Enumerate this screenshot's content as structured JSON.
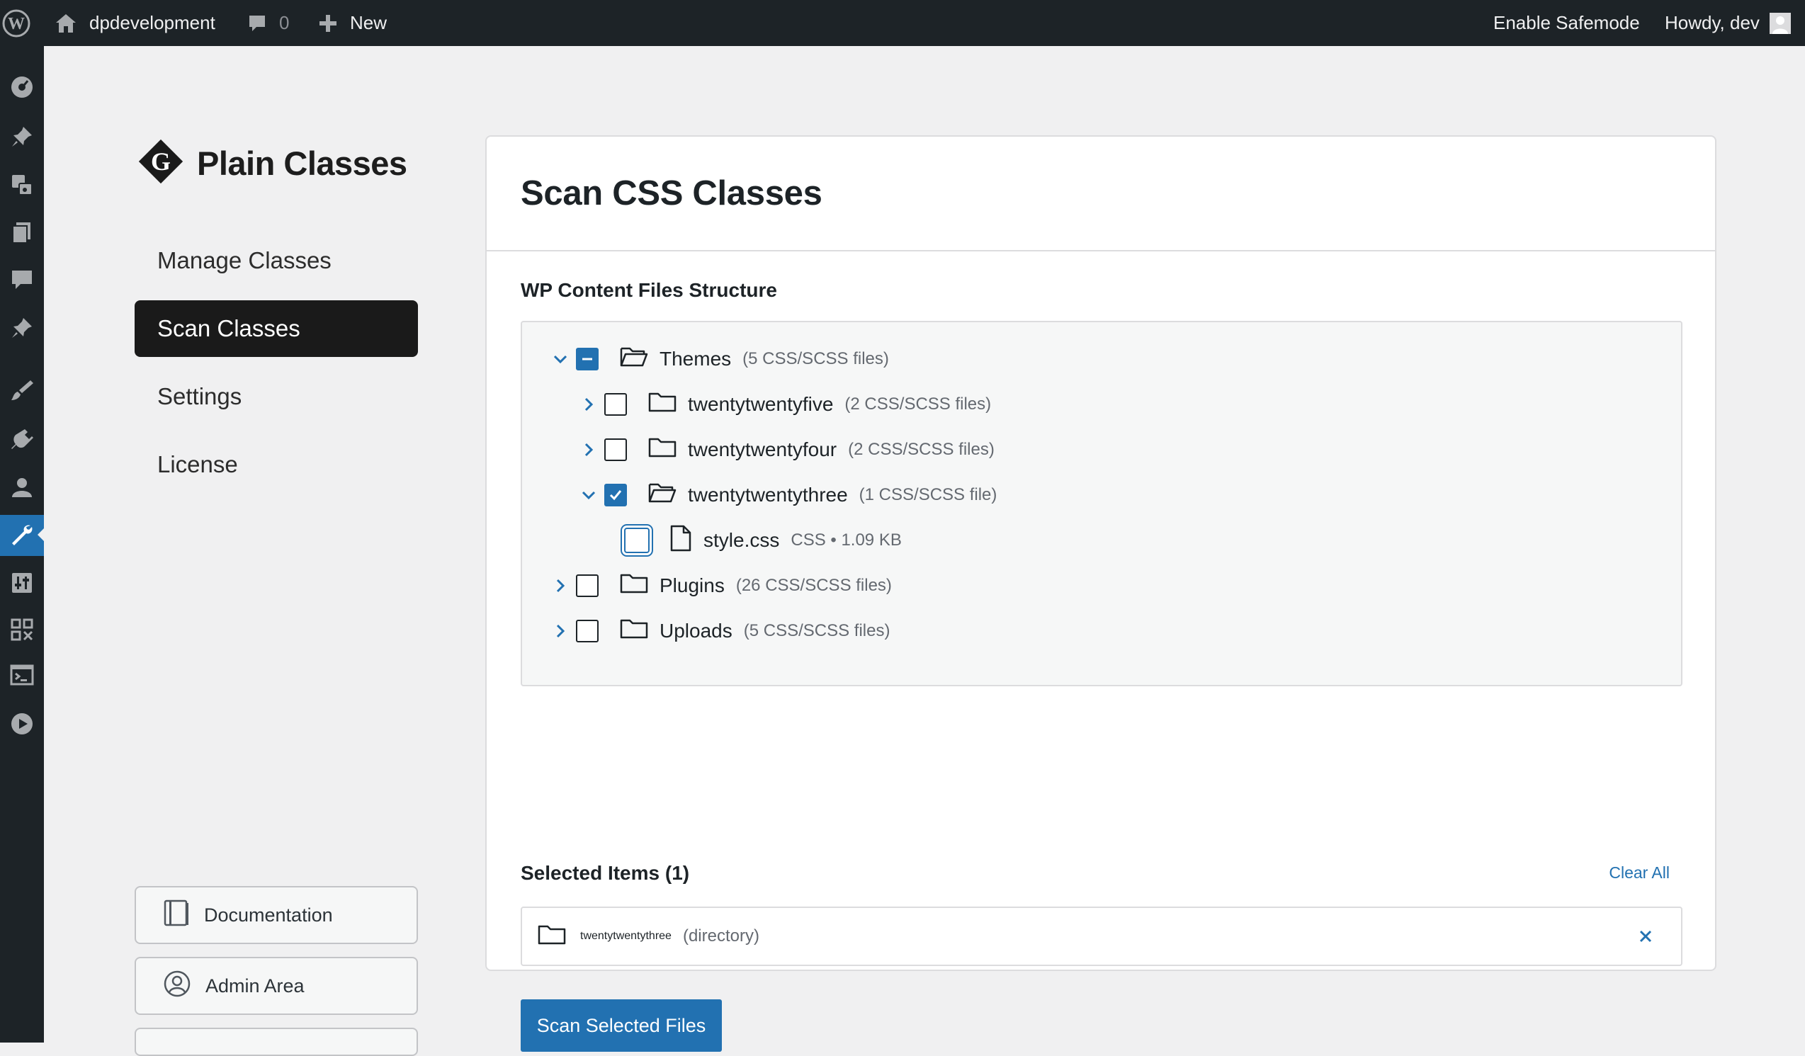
{
  "adminbar": {
    "site_name": "dpdevelopment",
    "comments_count": "0",
    "new_label": "New",
    "safemode_label": "Enable Safemode",
    "howdy_label": "Howdy, dev"
  },
  "sidebar": {
    "brand": "Plain Classes",
    "nav": [
      {
        "label": "Manage Classes"
      },
      {
        "label": "Scan Classes",
        "active": true
      },
      {
        "label": "Settings"
      },
      {
        "label": "License"
      }
    ],
    "buttons": [
      {
        "label": "Documentation",
        "icon": "book-icon"
      },
      {
        "label": "Admin Area",
        "icon": "user-circle-icon"
      }
    ]
  },
  "main": {
    "title": "Scan CSS Classes",
    "section_label": "WP Content Files Structure",
    "tree": [
      {
        "name": "Themes",
        "meta": "(5 CSS/SCSS files)",
        "state": "indeterminate",
        "expanded": true
      },
      {
        "name": "twentytwentyfive",
        "meta": "(2 CSS/SCSS files)",
        "state": "unchecked",
        "expanded": false
      },
      {
        "name": "twentytwentyfour",
        "meta": "(2 CSS/SCSS files)",
        "state": "unchecked",
        "expanded": false
      },
      {
        "name": "twentytwentythree",
        "meta": "(1 CSS/SCSS file)",
        "state": "checked",
        "expanded": true
      },
      {
        "name": "style.css",
        "meta": "CSS • 1.09 KB",
        "state": "unchecked"
      },
      {
        "name": "Plugins",
        "meta": "(26 CSS/SCSS files)",
        "state": "unchecked",
        "expanded": false
      },
      {
        "name": "Uploads",
        "meta": "(5 CSS/SCSS files)",
        "state": "unchecked",
        "expanded": false
      }
    ],
    "selected_label": "Selected Items (1)",
    "clear_all": "Clear All",
    "selected_items": [
      {
        "name": "twentytwentythree",
        "meta": "(directory)"
      }
    ],
    "scan_button": "Scan Selected Files"
  },
  "colors": {
    "accent": "#2271b1",
    "adminbar_bg": "#1d2327",
    "nav_active_bg": "#1a1a1a",
    "page_bg": "#f0f0f1"
  }
}
